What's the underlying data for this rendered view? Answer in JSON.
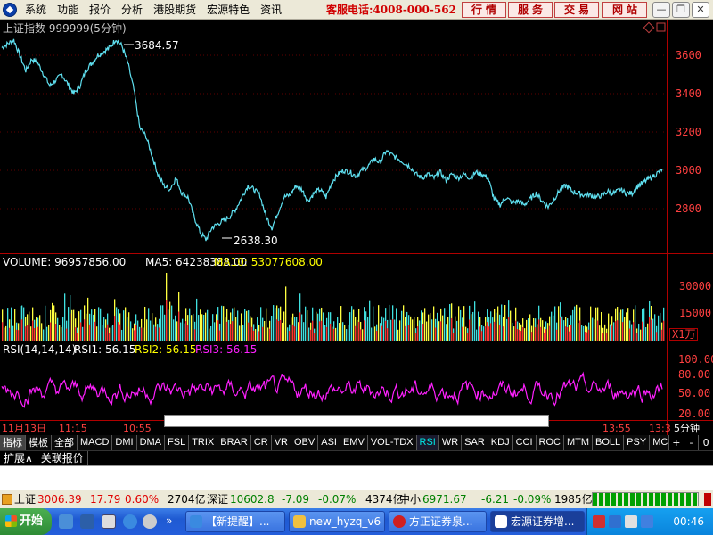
{
  "menubar": {
    "items": [
      "系统",
      "功能",
      "报价",
      "分析",
      "港股期货",
      "宏源特色",
      "资讯"
    ],
    "hotline": "客服电话:4008-000-562",
    "quick_buttons": [
      "行情",
      "服务",
      "交易",
      "网站"
    ]
  },
  "price_panel": {
    "title": "上证指数 999999(5分钟)",
    "high_marker": "3684.57",
    "low_marker": "2638.30",
    "y_ticks": [
      "3600",
      "3400",
      "3200",
      "3000",
      "2800"
    ],
    "line_color": "#5fe0f0"
  },
  "volume_panel": {
    "label": "VOLUME: 96957856.00",
    "ma5": "MA5: 64238388.00",
    "ma10": "MA10: 53077608.00",
    "y_ticks": [
      "30000",
      "15000"
    ],
    "unit": "X1万"
  },
  "rsi_panel": {
    "label": "RSI(14,14,14)",
    "rsi1": "RSI1: 56.15",
    "rsi2": "RSI2: 56.15",
    "rsi3": "RSI3: 56.15",
    "y_ticks": [
      "100.00",
      "80.00",
      "50.00",
      "20.00"
    ],
    "line_color": "#ff20ff"
  },
  "x_axis": {
    "labels": [
      "11月13日",
      "11:15",
      "10:55",
      "13:55",
      "13:3"
    ],
    "period": "5分钟"
  },
  "chart_data": {
    "type": "line",
    "title": "上证指数 999999(5分钟)",
    "xlabel": "",
    "ylabel": "",
    "ylim": [
      2600,
      3750
    ],
    "annotations": [
      {
        "label": "3684.57",
        "value": 3684.57
      },
      {
        "label": "2638.30",
        "value": 2638.3
      }
    ],
    "series": [
      {
        "name": "上证指数",
        "values": [
          3640,
          3660,
          3680,
          3600,
          3520,
          3580,
          3560,
          3500,
          3440,
          3470,
          3500,
          3450,
          3400,
          3440,
          3520,
          3560,
          3600,
          3620,
          3640,
          3684.57,
          3650,
          3560,
          3420,
          3220,
          3180,
          3080,
          2980,
          2920,
          2900,
          2960,
          2880,
          2860,
          2760,
          2680,
          2638.3,
          2700,
          2720,
          2740,
          2760,
          2800,
          2860,
          2920,
          2900,
          2870,
          2760,
          2700,
          2780,
          2860,
          2870,
          2920,
          2900,
          2840,
          2880,
          2900,
          2860,
          2940,
          2980,
          3000,
          2990,
          2970,
          3000,
          3020,
          3060,
          3040,
          3100,
          3080,
          3060,
          3040,
          3020,
          2980,
          2960,
          2980,
          2960,
          2990,
          2950,
          2980,
          2960,
          2980,
          2960,
          2990,
          2980,
          2960,
          2850,
          2820,
          2860,
          2830,
          2840,
          2820,
          2850,
          2880,
          2840,
          2810,
          2850,
          2900,
          2920,
          2890,
          2880,
          2870,
          2870,
          2860,
          2870,
          2890,
          2880,
          2900,
          2880,
          2880,
          2920,
          2940,
          2960,
          2980,
          3006.39
        ]
      }
    ]
  },
  "indicator_tabs": [
    "指标",
    "模板",
    "全部",
    "MACD",
    "DMI",
    "DMA",
    "FSL",
    "TRIX",
    "BRAR",
    "CR",
    "VR",
    "OBV",
    "ASI",
    "EMV",
    "VOL-TDX",
    "RSI",
    "WR",
    "SAR",
    "KDJ",
    "CCI",
    "ROC",
    "MTM",
    "BOLL",
    "PSY",
    "MCST"
  ],
  "tab_right": [
    "+",
    "-",
    "0"
  ],
  "expand_bar": [
    "扩展∧",
    "关联报价"
  ],
  "status": {
    "sh_label": "上证",
    "sh_value": "3006.39",
    "sh_change": "17.79",
    "sh_pct": "0.60%",
    "sh_amount": "2704亿",
    "sz_label": "深证",
    "sz_value": "10602.8",
    "sz_change": "-7.09",
    "sz_pct": "-0.07%",
    "sz_amount": "4374亿",
    "zx_label": "中小",
    "zx_value": "6971.67",
    "zx_change": "-6.21",
    "zx_pct": "-0.09%",
    "zx_amount": "1985亿"
  },
  "taskbar": {
    "start": "开始",
    "tasks": [
      "【新提醒】...",
      "new_hyzq_v6",
      "方正证券泉...",
      "宏源证券增..."
    ],
    "clock": "00:46"
  }
}
